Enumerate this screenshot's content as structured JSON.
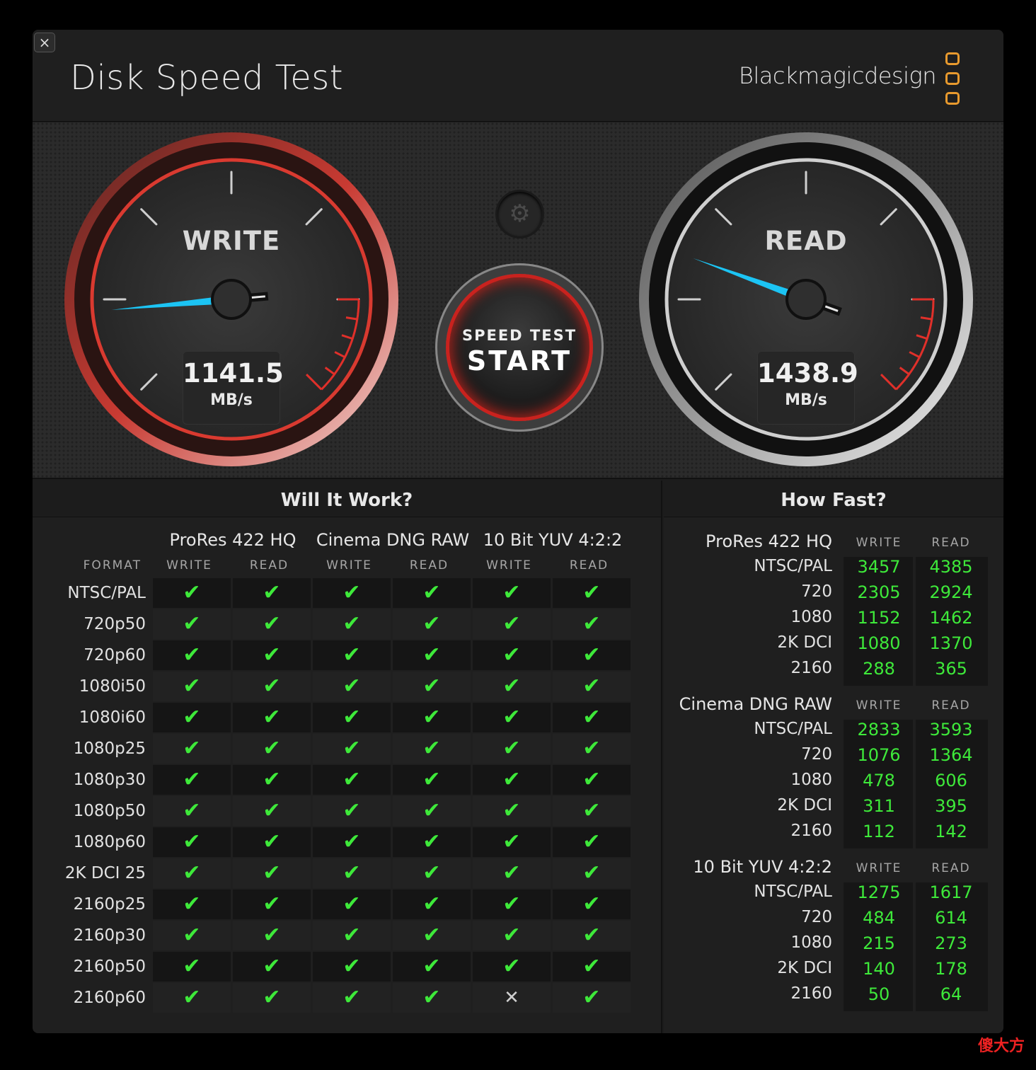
{
  "window": {
    "title": "Disk Speed Test",
    "brand": "Blackmagicdesign",
    "close_icon": "×"
  },
  "gauges": {
    "write": {
      "label": "WRITE",
      "value": "1141.5",
      "unit": "MB/s",
      "needle_deg": -5
    },
    "read": {
      "label": "READ",
      "value": "1438.9",
      "unit": "MB/s",
      "needle_deg": 20
    }
  },
  "start_button": {
    "small": "SPEED TEST",
    "big": "START"
  },
  "settings_icon": "⚙",
  "will_it_work": {
    "title": "Will It Work?",
    "format_label": "FORMAT",
    "groups": [
      "ProRes 422 HQ",
      "Cinema DNG RAW",
      "10 Bit YUV 4:2:2"
    ],
    "sub_cols": [
      "WRITE",
      "READ"
    ],
    "rows": [
      {
        "format": "NTSC/PAL",
        "results": [
          1,
          1,
          1,
          1,
          1,
          1
        ]
      },
      {
        "format": "720p50",
        "results": [
          1,
          1,
          1,
          1,
          1,
          1
        ]
      },
      {
        "format": "720p60",
        "results": [
          1,
          1,
          1,
          1,
          1,
          1
        ]
      },
      {
        "format": "1080i50",
        "results": [
          1,
          1,
          1,
          1,
          1,
          1
        ]
      },
      {
        "format": "1080i60",
        "results": [
          1,
          1,
          1,
          1,
          1,
          1
        ]
      },
      {
        "format": "1080p25",
        "results": [
          1,
          1,
          1,
          1,
          1,
          1
        ]
      },
      {
        "format": "1080p30",
        "results": [
          1,
          1,
          1,
          1,
          1,
          1
        ]
      },
      {
        "format": "1080p50",
        "results": [
          1,
          1,
          1,
          1,
          1,
          1
        ]
      },
      {
        "format": "1080p60",
        "results": [
          1,
          1,
          1,
          1,
          1,
          1
        ]
      },
      {
        "format": "2K DCI 25",
        "results": [
          1,
          1,
          1,
          1,
          1,
          1
        ]
      },
      {
        "format": "2160p25",
        "results": [
          1,
          1,
          1,
          1,
          1,
          1
        ]
      },
      {
        "format": "2160p30",
        "results": [
          1,
          1,
          1,
          1,
          1,
          1
        ]
      },
      {
        "format": "2160p50",
        "results": [
          1,
          1,
          1,
          1,
          1,
          1
        ]
      },
      {
        "format": "2160p60",
        "results": [
          1,
          1,
          1,
          1,
          0,
          1
        ]
      }
    ],
    "check_icon": "✔",
    "cross_icon": "✕"
  },
  "how_fast": {
    "title": "How Fast?",
    "col_write": "WRITE",
    "col_read": "READ",
    "groups": [
      {
        "name": "ProRes 422 HQ",
        "rows": [
          {
            "label": "NTSC/PAL",
            "write": "3457",
            "read": "4385"
          },
          {
            "label": "720",
            "write": "2305",
            "read": "2924"
          },
          {
            "label": "1080",
            "write": "1152",
            "read": "1462"
          },
          {
            "label": "2K DCI",
            "write": "1080",
            "read": "1370"
          },
          {
            "label": "2160",
            "write": "288",
            "read": "365"
          }
        ]
      },
      {
        "name": "Cinema DNG RAW",
        "rows": [
          {
            "label": "NTSC/PAL",
            "write": "2833",
            "read": "3593"
          },
          {
            "label": "720",
            "write": "1076",
            "read": "1364"
          },
          {
            "label": "1080",
            "write": "478",
            "read": "606"
          },
          {
            "label": "2K DCI",
            "write": "311",
            "read": "395"
          },
          {
            "label": "2160",
            "write": "112",
            "read": "142"
          }
        ]
      },
      {
        "name": "10 Bit YUV 4:2:2",
        "rows": [
          {
            "label": "NTSC/PAL",
            "write": "1275",
            "read": "1617"
          },
          {
            "label": "720",
            "write": "484",
            "read": "614"
          },
          {
            "label": "1080",
            "write": "215",
            "read": "273"
          },
          {
            "label": "2K DCI",
            "write": "140",
            "read": "178"
          },
          {
            "label": "2160",
            "write": "50",
            "read": "64"
          }
        ]
      }
    ]
  },
  "watermark": "傻大方",
  "colors": {
    "accent_green": "#3ee93a",
    "accent_red": "#e0302a",
    "needle_blue": "#1cc4f4",
    "logo_orange": "#e89a2e"
  }
}
